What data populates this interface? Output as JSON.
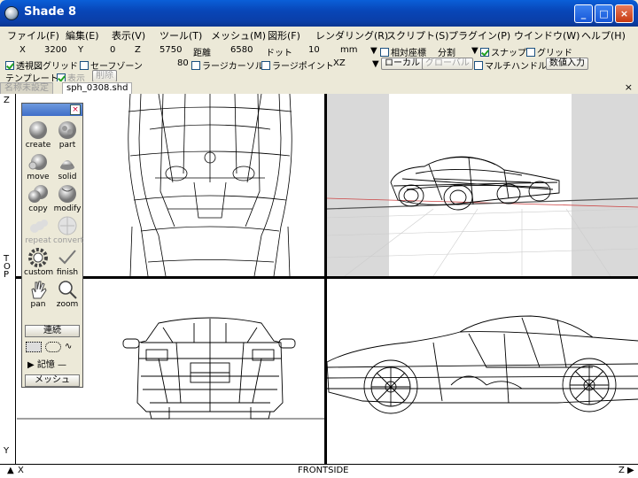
{
  "window": {
    "title": "Shade 8",
    "minimize": "_",
    "maximize": "□",
    "close": "×"
  },
  "menu": [
    "ファイル(F)",
    "編集(E)",
    "表示(V)",
    "ツール(T)",
    "メッシュ(M)",
    "図形(F)",
    "レンダリング(R)",
    "スクリプト(S)",
    "プラグイン(P)",
    "ウインドウ(W)",
    "ヘルプ(H)"
  ],
  "coords": {
    "x_label": "X",
    "x_value": "3200",
    "y_label": "Y",
    "y_value": "0",
    "z_label": "Z",
    "z_value": "5750",
    "dist_label": "距離",
    "dist_value": "6580",
    "dot_label": "ドット",
    "dot_value": "10",
    "unit": "mm",
    "relative_label": "相対座標",
    "split_label": "分割",
    "snap_label": "スナップ",
    "grid_label": "グリッド"
  },
  "row2": {
    "perspective_grid_label": "透視図グリッド",
    "safe_zone_label": "セーフゾーン",
    "value_80": "80",
    "large_cursor_label": "ラージカーソル",
    "large_point_label": "ラージポイント",
    "plane": "XZ",
    "local_button": "ローカル",
    "global_button": "グローバル",
    "multi_handle_label": "マルチハンドル",
    "numeric_input_button": "数値入力"
  },
  "row3": {
    "template_label": "テンプレート",
    "display_label": "表示",
    "delete_button": "削除"
  },
  "files": {
    "tab1": "名称未設定",
    "tab2": "sph_0308.shd",
    "close": "×"
  },
  "rulers": {
    "z_top": "Z",
    "top_label": "TOP",
    "y_bottom": "Y",
    "x_left": "X",
    "front_side": "FRONTSIDE",
    "z_right": "Z"
  },
  "palette": {
    "close": "×",
    "tools": [
      {
        "label": "create",
        "icon": "sphere-icon"
      },
      {
        "label": "part",
        "icon": "part-icon"
      },
      {
        "label": "move",
        "icon": "move-icon"
      },
      {
        "label": "solid",
        "icon": "solid-icon"
      },
      {
        "label": "copy",
        "icon": "copy-icon"
      },
      {
        "label": "modify",
        "icon": "modify-icon"
      },
      {
        "label": "repeat",
        "icon": "repeat-icon"
      },
      {
        "label": "convert",
        "icon": "convert-icon"
      },
      {
        "label": "custom",
        "icon": "gear-icon"
      },
      {
        "label": "finish",
        "icon": "check-icon"
      },
      {
        "label": "pan",
        "icon": "hand-icon"
      },
      {
        "label": "zoom",
        "icon": "magnifier-icon"
      }
    ],
    "continuous_button": "連続",
    "memory_label": "記憶",
    "mesh_button": "メッシュ"
  }
}
